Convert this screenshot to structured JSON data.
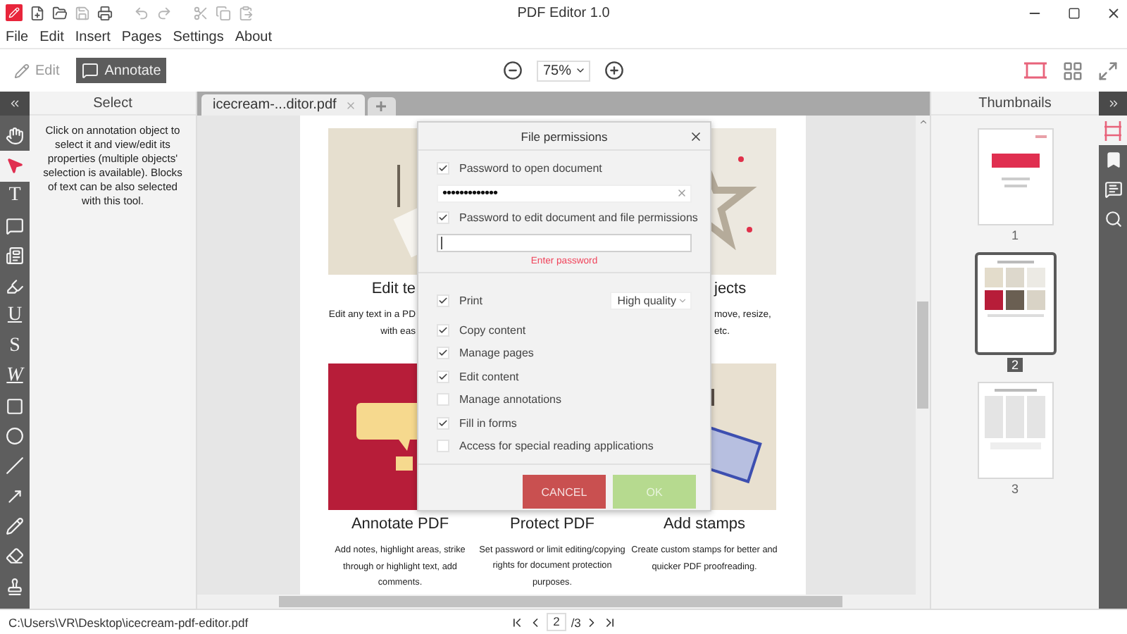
{
  "title_bar": {
    "title": "PDF Editor 1.0",
    "quick_actions": [
      {
        "kind": "new",
        "disabled": false
      },
      {
        "kind": "open",
        "disabled": false
      },
      {
        "kind": "save",
        "disabled": true
      },
      {
        "kind": "print",
        "disabled": false
      },
      {
        "kind": "undo",
        "disabled": true
      },
      {
        "kind": "redo",
        "disabled": true
      },
      {
        "kind": "cut",
        "disabled": true
      },
      {
        "kind": "copy",
        "disabled": true
      },
      {
        "kind": "paste",
        "disabled": true
      }
    ]
  },
  "menu": [
    "File",
    "Edit",
    "Insert",
    "Pages",
    "Settings",
    "About"
  ],
  "mode_tabs": [
    {
      "label": "Edit",
      "kind": "edit",
      "selected": false
    },
    {
      "label": "Annotate",
      "kind": "annotate",
      "selected": true
    }
  ],
  "zoom": {
    "value": "75%"
  },
  "view_modes": [
    {
      "kind": "single",
      "selected": true
    },
    {
      "kind": "grid",
      "selected": false
    },
    {
      "kind": "fullscreen",
      "selected": false
    }
  ],
  "tools": [
    {
      "kind": "hand",
      "selected": false
    },
    {
      "kind": "select",
      "selected": true
    },
    {
      "kind": "letter",
      "glyph": "T",
      "selected": false
    },
    {
      "kind": "comment",
      "selected": false
    },
    {
      "kind": "textbox",
      "selected": false
    },
    {
      "kind": "highlight",
      "selected": false
    },
    {
      "kind": "underline",
      "glyph": "U",
      "selected": false
    },
    {
      "kind": "strikeout",
      "glyph": "S",
      "selected": false
    },
    {
      "kind": "squiggly",
      "glyph": "W",
      "selected": false
    },
    {
      "kind": "rectangle",
      "selected": false
    },
    {
      "kind": "ellipse",
      "selected": false
    },
    {
      "kind": "line",
      "selected": false
    },
    {
      "kind": "arrow",
      "selected": false
    },
    {
      "kind": "pencil",
      "selected": false
    },
    {
      "kind": "eraser",
      "selected": false
    },
    {
      "kind": "stamp",
      "selected": false
    }
  ],
  "tool_panel": {
    "title": "Select",
    "description": "Click on annotation object to select it and view/edit its properties (multiple objects' selection is available). Blocks of text can be also selected with this tool."
  },
  "document_tabs": [
    {
      "label": "icecream-...ditor.pdf",
      "selected": true
    }
  ],
  "page": {
    "top_row": [
      {
        "kind": "text",
        "title": "Edit te",
        "description_lines": [
          "Edit any text in a PD",
          "with eas"
        ]
      },
      {
        "kind": "objects",
        "title": "jects",
        "description_lines": [
          "move, resize,",
          "etc."
        ]
      }
    ],
    "bottom_row": [
      {
        "kind": "annotate",
        "title": "Annotate PDF",
        "description": "Add notes, highlight areas, strike through or highlight text, add comments."
      },
      {
        "kind": "protect",
        "title": "Protect PDF",
        "description": "Set password or limit editing/copying rights for document protection purposes."
      },
      {
        "kind": "stamps",
        "title": "Add stamps",
        "description": "Create custom stamps for better and quicker PDF proofreading."
      }
    ]
  },
  "dialog": {
    "title": "File permissions",
    "open_password": {
      "label": "Password to open document",
      "checked": true,
      "value": "•••••••••••••"
    },
    "edit_password": {
      "label": "Password to edit document and file permissions",
      "checked": true,
      "error": "Enter password"
    },
    "print": {
      "label": "Print",
      "checked": true,
      "quality": "High quality"
    },
    "permissions": [
      {
        "label": "Copy content",
        "checked": true
      },
      {
        "label": "Manage pages",
        "checked": true
      },
      {
        "label": "Edit content",
        "checked": true
      },
      {
        "label": "Manage annotations",
        "checked": false
      },
      {
        "label": "Fill in forms",
        "checked": true
      },
      {
        "label": "Access for special reading applications",
        "checked": false
      }
    ],
    "buttons": [
      {
        "label": "CANCEL",
        "kind": "cancel",
        "disabled": false
      },
      {
        "label": "OK",
        "kind": "ok",
        "disabled": true
      }
    ]
  },
  "thumbnails_panel": {
    "title": "Thumbnails"
  },
  "thumbnails": [
    {
      "number": "1",
      "kind": "cover",
      "selected": false
    },
    {
      "number": "2",
      "kind": "features",
      "selected": true
    },
    {
      "number": "3",
      "kind": "screens",
      "selected": false
    }
  ],
  "side_panels": [
    {
      "kind": "thumbnails",
      "selected": true
    },
    {
      "kind": "bookmarks",
      "selected": false
    },
    {
      "kind": "comments",
      "selected": false
    },
    {
      "kind": "search",
      "selected": false
    }
  ],
  "status_bar": {
    "path": "C:\\Users\\VR\\Desktop\\icecream-pdf-editor.pdf",
    "page": "2",
    "page_count": "/3"
  }
}
